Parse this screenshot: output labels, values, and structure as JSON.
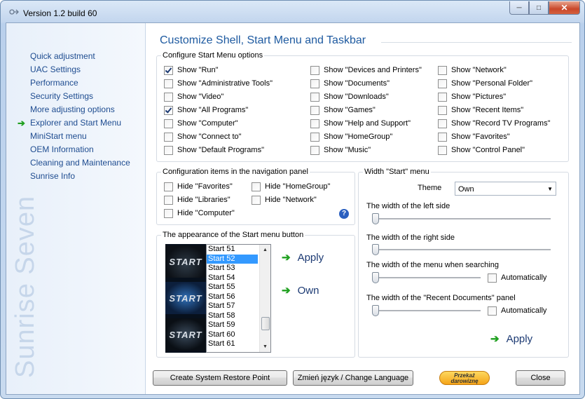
{
  "window": {
    "title": "Version 1.2 build 60",
    "minimize_glyph": "─",
    "maximize_glyph": "□",
    "close_glyph": "✕"
  },
  "sidebar": {
    "items": [
      {
        "label": "Quick adjustment"
      },
      {
        "label": "UAC Settings"
      },
      {
        "label": "Performance"
      },
      {
        "label": "Security Settings"
      },
      {
        "label": "More adjusting options"
      },
      {
        "label": "Explorer and Start Menu",
        "active": true
      },
      {
        "label": "MiniStart menu"
      },
      {
        "label": "OEM Information"
      },
      {
        "label": "Cleaning and Maintenance"
      },
      {
        "label": "Sunrise Info"
      }
    ],
    "active_arrow": "➔",
    "brand": "Sunrise Seven"
  },
  "page": {
    "heading": "Customize Shell, Start Menu and Taskbar"
  },
  "start_menu_options": {
    "legend": "Configure Start Menu options",
    "col1": [
      {
        "label": "Show \"Run\"",
        "checked": true
      },
      {
        "label": "Show \"Administrative Tools\"",
        "checked": false
      },
      {
        "label": "Show \"Video\"",
        "checked": false
      },
      {
        "label": "Show \"All Programs\"",
        "checked": true
      },
      {
        "label": "Show \"Computer\"",
        "checked": false
      },
      {
        "label": "Show \"Connect to\"",
        "checked": false
      },
      {
        "label": "Show \"Default Programs\"",
        "checked": false
      }
    ],
    "col2": [
      {
        "label": "Show \"Devices and Printers\"",
        "checked": false
      },
      {
        "label": "Show \"Documents\"",
        "checked": false
      },
      {
        "label": "Show \"Downloads\"",
        "checked": false
      },
      {
        "label": "Show \"Games\"",
        "checked": false
      },
      {
        "label": "Show \"Help and Support\"",
        "checked": false
      },
      {
        "label": "Show \"HomeGroup\"",
        "checked": false
      },
      {
        "label": "Show \"Music\"",
        "checked": false
      }
    ],
    "col3": [
      {
        "label": "Show \"Network\"",
        "checked": false
      },
      {
        "label": "Show \"Personal Folder\"",
        "checked": false
      },
      {
        "label": "Show \"Pictures\"",
        "checked": false
      },
      {
        "label": "Show \"Recent Items\"",
        "checked": false
      },
      {
        "label": "Show \"Record TV Programs\"",
        "checked": false
      },
      {
        "label": "Show \"Favorites\"",
        "checked": false
      },
      {
        "label": "Show \"Control Panel\"",
        "checked": false
      }
    ]
  },
  "nav_panel": {
    "legend": "Configuration items in the navigation panel",
    "items": [
      {
        "label": "Hide \"Favorites\"",
        "checked": false
      },
      {
        "label": "Hide \"HomeGroup\"",
        "checked": false
      },
      {
        "label": "Hide \"Libraries\"",
        "checked": false
      },
      {
        "label": "Hide \"Network\"",
        "checked": false
      },
      {
        "label": "Hide \"Computer\"",
        "checked": false
      }
    ],
    "help": "?"
  },
  "start_button": {
    "legend": "The appearance of the Start menu button",
    "preview_label": "START",
    "styles": [
      "Start 51",
      "Start 52",
      "Start 53",
      "Start 54",
      "Start 55",
      "Start 56",
      "Start 57",
      "Start 58",
      "Start 59",
      "Start 60",
      "Start 61"
    ],
    "selected": "Start 52",
    "scroll_up": "▲",
    "scroll_down": "▼",
    "apply_label": "Apply",
    "own_label": "Own",
    "arrow": "➔"
  },
  "width_panel": {
    "legend": "Width \"Start\" menu",
    "theme_label": "Theme",
    "theme_value": "Own",
    "dropdown_glyph": "▼",
    "left_side_label": "The width of the left side",
    "left_side_value": 0,
    "right_side_label": "The width of the right side",
    "right_side_value": 0,
    "search_label": "The width of the menu when searching",
    "search_value": 0,
    "search_auto_label": "Automatically",
    "search_auto_checked": false,
    "recent_label": "The width of the \"Recent Documents\" panel",
    "recent_value": 0,
    "recent_auto_label": "Automatically",
    "recent_auto_checked": false,
    "apply_label": "Apply",
    "arrow": "➔"
  },
  "footer": {
    "restore_label": "Create System Restore Point",
    "language_label": "Zmień język / Change Language",
    "donate_line1": "Przekaż",
    "donate_line2": "darowiznę",
    "close_label": "Close"
  },
  "colors": {
    "accent": "#1e5aa0",
    "nav_link": "#1e4c90",
    "arrow": "#20a020",
    "selection": "#3399ff"
  }
}
